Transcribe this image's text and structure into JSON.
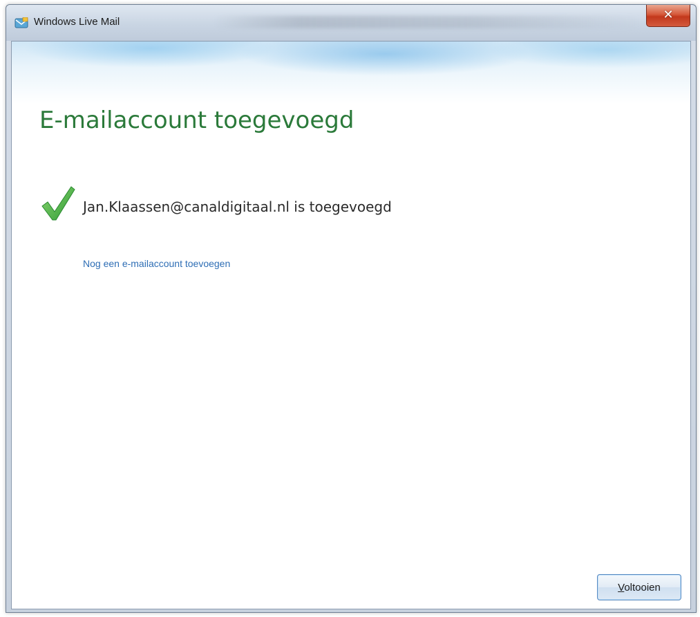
{
  "window": {
    "title": "Windows Live Mail",
    "close_glyph": "✕"
  },
  "page": {
    "heading": "E-mailaccount toegevoegd",
    "status_text": "Jan.Klaassen@canaldigitaal.nl is toegevoegd",
    "add_account_link": "Nog een e-mailaccount toevoegen"
  },
  "footer": {
    "finish_mnemonic": "V",
    "finish_rest": "oltooien"
  },
  "icons": {
    "app": "windows-live-mail-icon",
    "close": "close-icon",
    "status": "checkmark-icon"
  },
  "colors": {
    "heading": "#2b7a3a",
    "link": "#2e6eb5",
    "check": "#4cb748"
  }
}
